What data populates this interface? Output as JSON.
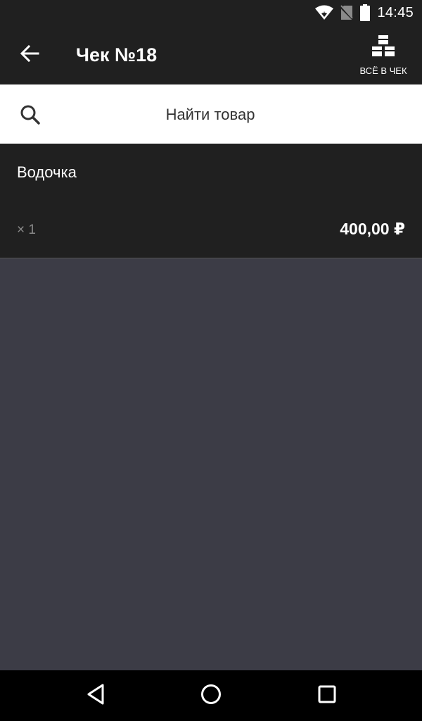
{
  "status_bar": {
    "time": "14:45",
    "icons": [
      "wifi-icon",
      "no-sim-icon",
      "battery-icon"
    ]
  },
  "app_bar": {
    "title": "Чек №18",
    "back_icon": "arrow-left-icon",
    "all_in_receipt": {
      "label": "ВСЁ В ЧЕК",
      "icon": "boxes-stack-icon"
    }
  },
  "search": {
    "placeholder": "Найти товар",
    "value": "",
    "icon": "search-icon"
  },
  "items": [
    {
      "name": "Водочка",
      "quantity": "× 1",
      "price": "400,00 ₽"
    }
  ],
  "nav_bar": {
    "icons": [
      "back-triangle-icon",
      "home-circle-icon",
      "recents-square-icon"
    ]
  },
  "colors": {
    "dark_bar": "#202020",
    "content_background": "#3c3c46",
    "search_background": "#ffffff"
  }
}
